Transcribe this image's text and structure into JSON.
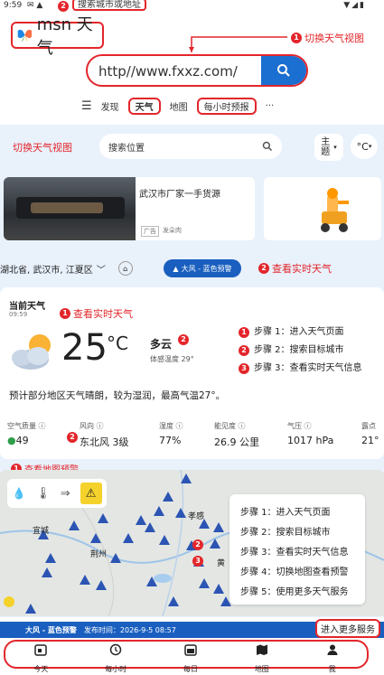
{
  "status_bar": {
    "time": "9:59",
    "annotation_num": "2",
    "annotation_text": "搜索城市或地址"
  },
  "header": {
    "logo_text": "msn 天气",
    "switch_annotation_num": "1",
    "switch_annotation_text": "切换天气视图",
    "url_value": "http//www.fxxz.com/"
  },
  "nav": {
    "items": [
      "发现",
      "天气",
      "地图",
      "每小时预报"
    ],
    "more": "···"
  },
  "toolbar": {
    "switch_annotation": "切换天气视图",
    "search_placeholder": "搜索位置",
    "theme_label": "主题",
    "unit_label": "°C"
  },
  "ad": {
    "title": "武汉市厂家一手货源",
    "tag": "广告",
    "source": "发朵肉"
  },
  "location": {
    "text": "湖北省, 武汉市, 江夏区",
    "alert_label": "大风 - 蓝色预警",
    "annotation_num": "2",
    "annotation_text": "查看实时天气"
  },
  "current": {
    "title": "当前天气",
    "time": "09:59",
    "annotation_num": "1",
    "annotation_text": "查看实时天气",
    "temp": "25",
    "unit": "°C",
    "condition": "多云",
    "feels_like": "体感温度 29°",
    "marker": "2",
    "forecast": "预计部分地区天气晴朗，较为湿润，最高气温27°。"
  },
  "steps_right": [
    {
      "num": "1",
      "text": "步骤 1：进入天气页面"
    },
    {
      "num": "2",
      "text": "步骤 2：搜索目标城市"
    },
    {
      "num": "3",
      "text": "步骤 3：查看实时天气信息"
    }
  ],
  "details": [
    {
      "label": "空气质量",
      "value": "49"
    },
    {
      "label": "风向",
      "value": "东北风 3级"
    },
    {
      "label": "湿度",
      "value": "77%"
    },
    {
      "label": "能见度",
      "value": "26.9 公里"
    },
    {
      "label": "气压",
      "value": "1017 hPa"
    },
    {
      "label": "露点",
      "value": "21°"
    }
  ],
  "details_marker": "2",
  "map": {
    "annotation_num": "1",
    "annotation_text": "查看地图预警",
    "places": [
      "宜城",
      "荆州",
      "孝感",
      "黄"
    ],
    "markers": [
      "2",
      "3"
    ],
    "steps": [
      "步骤 1：进入天气页面",
      "步骤 2：搜索目标城市",
      "步骤 3：查看实时天气信息",
      "步骤 4：切换地图查看预警",
      "步骤 5：使用更多天气服务"
    ],
    "warning_title": "大风 - 蓝色预警",
    "warning_time": "发布时间：2026-9-5 08:57",
    "more_services": "进入更多服务"
  },
  "bottom_nav": [
    "今天",
    "每小时",
    "每日",
    "地图",
    "我"
  ],
  "colors": {
    "accent_red": "#e3262b",
    "brand_blue": "#1a6fd0",
    "alert_blue": "#1a5fbf"
  }
}
